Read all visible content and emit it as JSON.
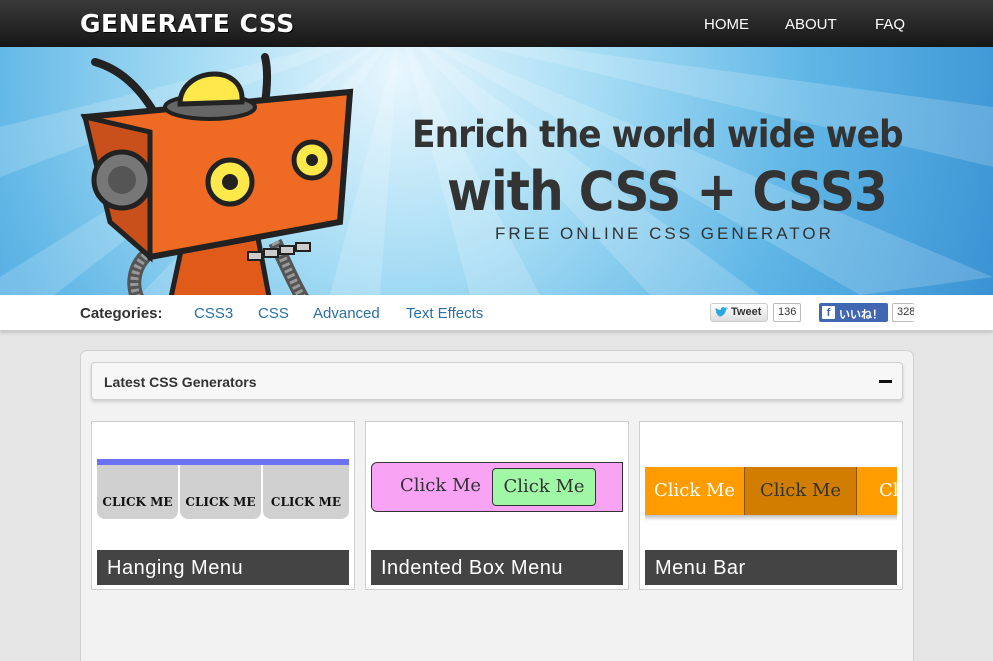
{
  "header": {
    "logo": "GENERATE CSS",
    "nav": [
      {
        "label": "HOME"
      },
      {
        "label": "ABOUT"
      },
      {
        "label": "FAQ"
      }
    ]
  },
  "banner": {
    "line1": "Enrich the world wide web",
    "line2": "with CSS + CSS3",
    "line3": "FREE ONLINE CSS GENERATOR"
  },
  "categories": {
    "label": "Categories:",
    "links": [
      {
        "label": "CSS3"
      },
      {
        "label": "CSS"
      },
      {
        "label": "Advanced"
      },
      {
        "label": "Text Effects"
      }
    ],
    "tweet_label": "Tweet",
    "tweet_count": "136",
    "like_label": "いいね！",
    "like_count": "328"
  },
  "panel": {
    "title": "Latest CSS Generators",
    "cards": [
      {
        "caption": "Hanging Menu",
        "preview_items": [
          "CLICK ME",
          "CLICK ME",
          "CLICK ME"
        ],
        "colors": {
          "bar": "#6a72f0",
          "item": "#d0d0d0"
        }
      },
      {
        "caption": "Indented Box Menu",
        "preview_items": [
          "Click Me",
          "Click Me"
        ],
        "colors": {
          "bg": "#f9a3f4",
          "active": "#a0f7a6"
        }
      },
      {
        "caption": "Menu Bar",
        "preview_items": [
          "Click Me",
          "Click Me",
          "Cl"
        ],
        "colors": {
          "item": "#ff9d00",
          "active": "#d17e00"
        }
      }
    ]
  }
}
